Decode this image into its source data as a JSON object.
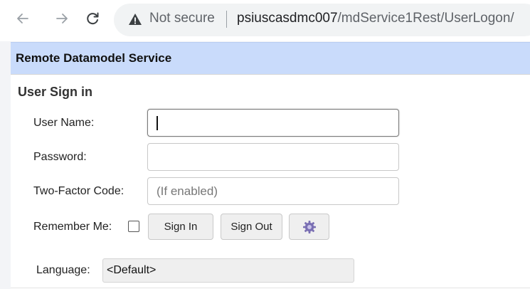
{
  "browser": {
    "security_label": "Not secure",
    "url_host": "psiuscasdmc007",
    "url_path": "/mdService1Rest/UserLogon/",
    "icons": [
      "back-arrow-icon",
      "forward-arrow-icon",
      "reload-icon",
      "warning-icon"
    ]
  },
  "page": {
    "title": "Remote Datamodel Service",
    "section_title": "User Sign in",
    "fields": {
      "username_label": "User Name:",
      "username_value": "",
      "password_label": "Password:",
      "password_value": "",
      "twofactor_label": "Two-Factor Code:",
      "twofactor_placeholder": "(If enabled)"
    },
    "remember_label": "Remember Me:",
    "remember_checked": false,
    "buttons": {
      "sign_in": "Sign In",
      "sign_out": "Sign Out",
      "settings_icon": "gear-icon"
    },
    "language_label": "Language:",
    "language_value": "<Default>"
  },
  "colors": {
    "titlebar_bg": "#c9dbfb",
    "button_bg": "#efefef",
    "gear": "#7a6fb3"
  }
}
